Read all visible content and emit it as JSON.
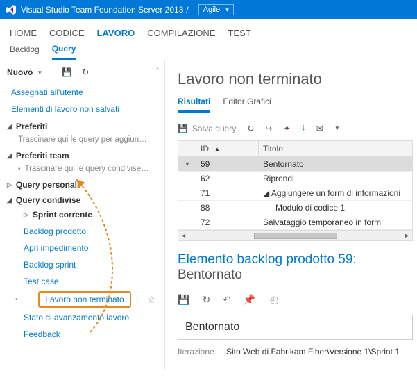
{
  "titlebar": {
    "product": "Visual Studio Team Foundation Server 2013",
    "separator": "/",
    "project": "Agile"
  },
  "hubnav": {
    "home": "HOME",
    "codice": "CODICE",
    "lavoro": "LAVORO",
    "compilazione": "COMPILAZIONE",
    "test": "TEST"
  },
  "subnav": {
    "backlog": "Backlog",
    "query": "Query"
  },
  "sidebar": {
    "new_label": "Nuovo",
    "links": {
      "assegnati": "Assegnati all'utente",
      "non_salvati": "Elementi di lavoro non salvati"
    },
    "sections": {
      "preferiti": "Preferiti",
      "preferiti_hint": "Trascinare qui le query per aggiun…",
      "preferiti_team": "Preferiti team",
      "preferiti_team_hint": "Trascinare qui le query condivise…",
      "query_personali": "Query personali",
      "query_condivise": "Query condivise"
    },
    "shared": {
      "sprint_corrente": "Sprint corrente",
      "backlog_prodotto": "Backlog prodotto",
      "apri_impedimento": "Apri impedimento",
      "backlog_sprint": "Backlog sprint",
      "test_case": "Test case",
      "lavoro_non_terminato": "Lavoro non terminato",
      "stato": "Stato di avanzamento lavoro",
      "feedback": "Feedback"
    }
  },
  "main": {
    "title": "Lavoro non terminato",
    "tabs": {
      "risultati": "Risultati",
      "editor": "Editor Grafici"
    },
    "toolbar": {
      "save_query": "Salva query"
    },
    "grid": {
      "cols": {
        "id": "ID",
        "titolo": "Titolo"
      },
      "rows": [
        {
          "id": "59",
          "title": "Bentornato",
          "expander": "▼",
          "selected": true,
          "indent": 0
        },
        {
          "id": "62",
          "title": "Riprendi",
          "indent": 0
        },
        {
          "id": "71",
          "title": "Aggiungere un form di informazioni",
          "indent": 0,
          "prefix": "◢"
        },
        {
          "id": "88",
          "title": "Modulo di codice 1",
          "indent": 1
        },
        {
          "id": "72",
          "title": "Salvataggio temporaneo in form",
          "indent": 0
        }
      ]
    },
    "detail": {
      "heading_lead": "Elemento backlog prodotto 59:",
      "heading_trail": "Bentornato",
      "item_title": "Bentornato",
      "iter_label": "Iterazione",
      "iter_value": "Sito Web di Fabrikam Fiber\\Versione 1\\Sprint 1"
    }
  }
}
